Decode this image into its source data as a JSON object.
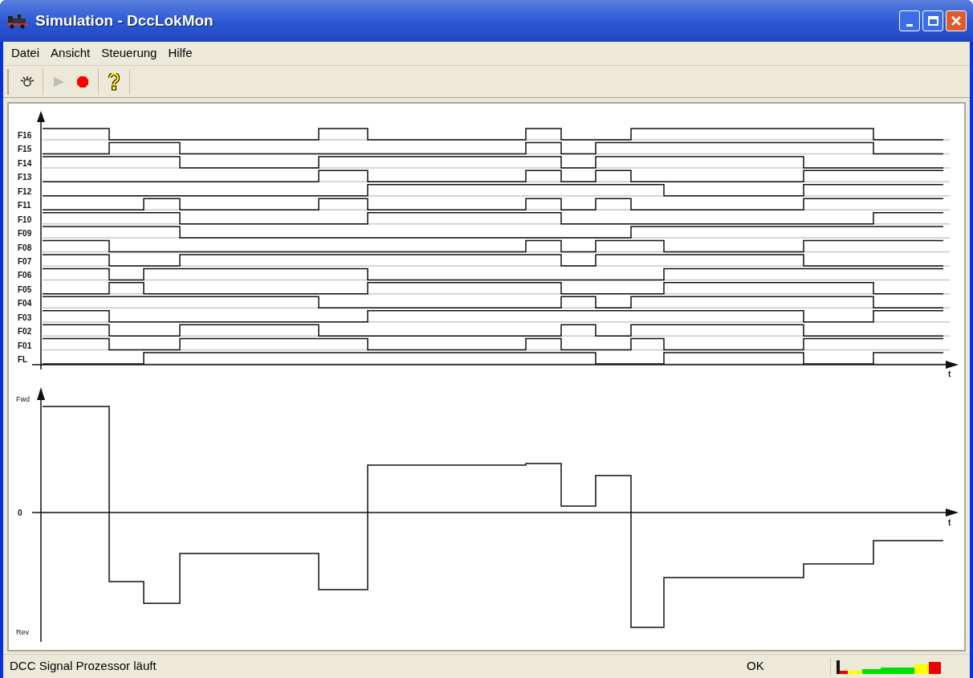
{
  "window": {
    "title": "Simulation - DccLokMon"
  },
  "menu": [
    "Datei",
    "Ansicht",
    "Steuerung",
    "Hilfe"
  ],
  "toolbar": [
    {
      "kind": "settings",
      "disabled": false
    },
    {
      "kind": "play",
      "disabled": true
    },
    {
      "kind": "stop",
      "disabled": false
    },
    {
      "kind": "help",
      "disabled": false
    }
  ],
  "function_chart": {
    "channels": [
      "F16",
      "F15",
      "F14",
      "F13",
      "F12",
      "F11",
      "F10",
      "F09",
      "F08",
      "F07",
      "F06",
      "F05",
      "F04",
      "F03",
      "F02",
      "F01",
      "FL"
    ],
    "time_label": "t"
  },
  "speed_chart": {
    "top_label": "Fwd",
    "zero_label": "0",
    "bottom_label": "Rev",
    "time_label": "t"
  },
  "status_bar": {
    "message": "DCC Signal Prozessor läuft",
    "state": "OK"
  }
}
